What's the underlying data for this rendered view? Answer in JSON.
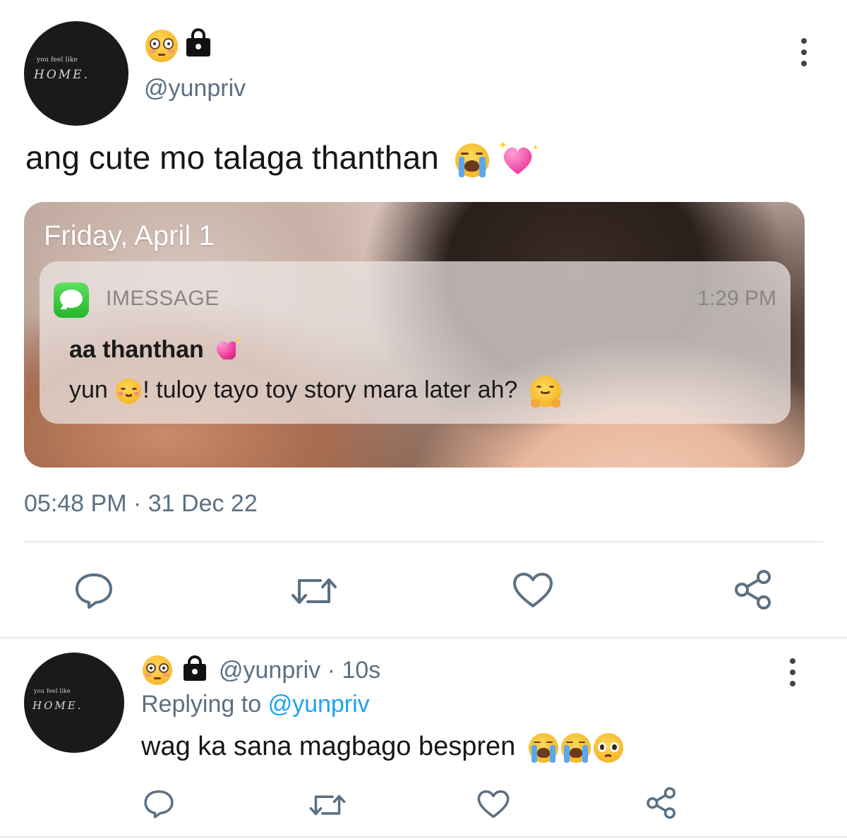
{
  "main_tweet": {
    "avatar": {
      "small_text": "you feel like",
      "big_text": "HOME."
    },
    "handle": "@yunpriv",
    "text": "ang cute mo talaga thanthan",
    "text_emojis": [
      "loudly-crying-face",
      "sparkling-heart"
    ],
    "image": {
      "date_text": "Friday, April 1",
      "notification": {
        "app_name": "IMESSAGE",
        "time": "1:29 PM",
        "title": "aa thanthan",
        "message_before": "yun",
        "message_after": "! tuloy tayo toy story mara later ah?"
      }
    },
    "timestamp": "05:48 PM · 31 Dec 22",
    "actions": [
      "reply-icon",
      "retweet-icon",
      "like-icon",
      "share-icon"
    ]
  },
  "reply_tweet": {
    "avatar": {
      "small_text": "you feel like",
      "big_text": "HOME."
    },
    "handle": "@yunpriv",
    "separator": " · ",
    "time_ago": "10s",
    "replying_prefix": "Replying to",
    "replying_to": "@yunpriv",
    "text": "wag ka sana magbago bespren",
    "text_emojis": [
      "loudly-crying-face",
      "loudly-crying-face",
      "pleading-face"
    ],
    "actions": [
      "reply-icon",
      "retweet-icon",
      "like-icon",
      "share-icon"
    ]
  },
  "colors": {
    "secondary_text": "#5b7083",
    "link": "#1da1f2",
    "divider": "#e6ecf0"
  }
}
